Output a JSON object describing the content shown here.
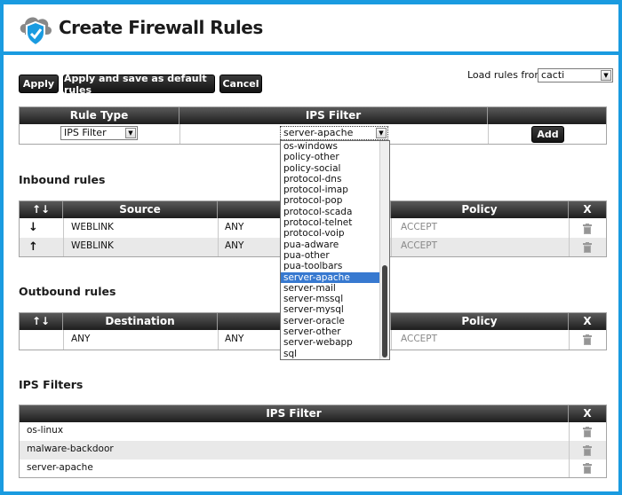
{
  "app": {
    "title": "Create Firewall Rules"
  },
  "toolbar": {
    "apply": "Apply",
    "apply_default": "Apply and save as default rules",
    "cancel": "Cancel"
  },
  "load_rules": {
    "label": "Load rules from:",
    "value": "cacti"
  },
  "rule_builder": {
    "col_rule_type": "Rule Type",
    "col_ips_filter": "IPS Filter",
    "rule_type_value": "IPS Filter",
    "ips_filter_value": "server-apache",
    "add": "Add"
  },
  "dropdown": {
    "options": [
      "os-windows",
      "policy-other",
      "policy-social",
      "protocol-dns",
      "protocol-imap",
      "protocol-pop",
      "protocol-scada",
      "protocol-telnet",
      "protocol-voip",
      "pua-adware",
      "pua-other",
      "pua-toolbars",
      "server-apache",
      "server-mail",
      "server-mssql",
      "server-mysql",
      "server-oracle",
      "server-other",
      "server-webapp",
      "sql"
    ],
    "selected": "server-apache"
  },
  "inbound": {
    "title": "Inbound rules",
    "arrows": "↑↓",
    "col_source": "Source",
    "col_policy": "Policy",
    "col_x": "X",
    "rows": [
      {
        "arrow": "↓",
        "source": "WEBLINK",
        "dest": "ANY",
        "policy": "ACCEPT"
      },
      {
        "arrow": "↑",
        "source": "WEBLINK",
        "dest": "ANY",
        "policy": "ACCEPT"
      }
    ]
  },
  "outbound": {
    "title": "Outbound rules",
    "arrows": "↑↓",
    "col_destination": "Destination",
    "col_policy": "Policy",
    "col_x": "X",
    "rows": [
      {
        "destination": "ANY",
        "source": "ANY",
        "policy": "ACCEPT"
      }
    ]
  },
  "ips_filters": {
    "title": "IPS Filters",
    "col_filter": "IPS Filter",
    "col_x": "X",
    "rows": [
      "os-linux",
      "malware-backdoor",
      "server-apache"
    ]
  }
}
